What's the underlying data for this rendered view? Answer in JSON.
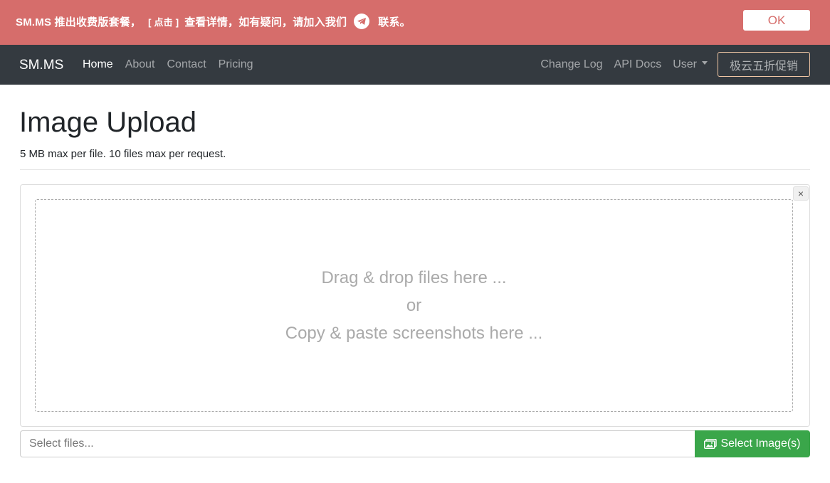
{
  "announcement": {
    "text_before": "SM.MS 推出收费版套餐，",
    "click_label": "[ 点击 ]",
    "text_after": "查看详情，如有疑问，请加入我们",
    "text_end": "联系。",
    "ok_label": "OK",
    "background": "#d66d6b"
  },
  "navbar": {
    "brand": "SM.MS",
    "left_items": [
      "Home",
      "About",
      "Contact",
      "Pricing"
    ],
    "right_items": [
      "Change Log",
      "API Docs"
    ],
    "user_label": "User",
    "promo_label": "极云五折促销",
    "background": "#343a40"
  },
  "main": {
    "title": "Image Upload",
    "subtitle": "5 MB max per file. 10 files max per request.",
    "drop_line1": "Drag & drop files here ...",
    "drop_line2": "or",
    "drop_line3": "Copy & paste screenshots here ...",
    "close_symbol": "×",
    "file_placeholder": "Select files...",
    "select_button": "Select Image(s)",
    "select_button_color": "#3aa64a"
  }
}
